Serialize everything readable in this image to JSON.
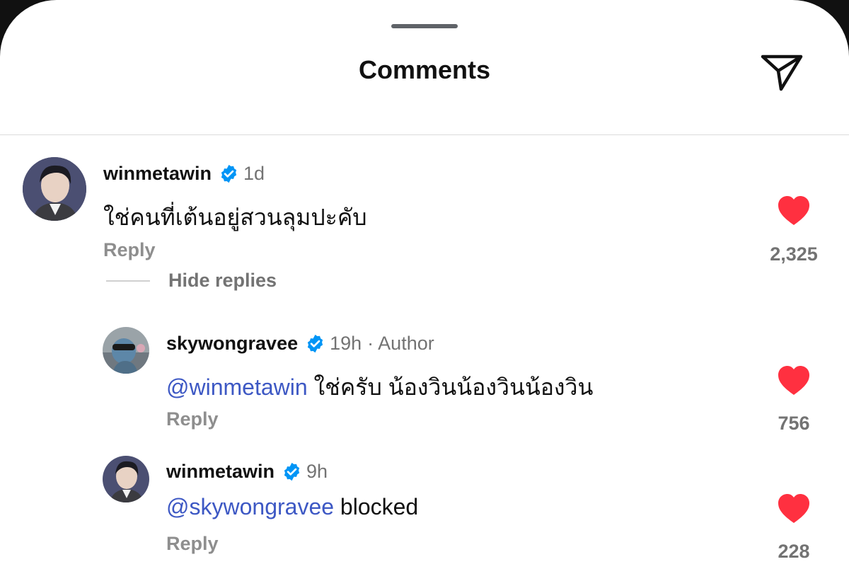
{
  "header": {
    "title": "Comments",
    "share_icon": "send-icon"
  },
  "comments": [
    {
      "username": "winmetawin",
      "verified": true,
      "time": "1d",
      "author_tag": "",
      "mention": "",
      "text": "ใช่คนที่เต้นอยู่สวนลุมปะคับ",
      "reply_label": "Reply",
      "likes": "2,325"
    },
    {
      "username": "skywongravee",
      "verified": true,
      "time": "19h",
      "author_tag": "· Author",
      "mention": "@winmetawin",
      "text": " ใช่ครับ น้องวินน้องวินน้องวิน",
      "reply_label": "Reply",
      "likes": "756"
    },
    {
      "username": "winmetawin",
      "verified": true,
      "time": "9h",
      "author_tag": "",
      "mention": "@skywongravee",
      "text": " blocked",
      "reply_label": "Reply",
      "likes": "228"
    }
  ],
  "hide_replies_label": "Hide replies",
  "colors": {
    "like_red": "#ff3040",
    "mention_blue": "#3d58c4",
    "verified_blue": "#0095f6"
  }
}
